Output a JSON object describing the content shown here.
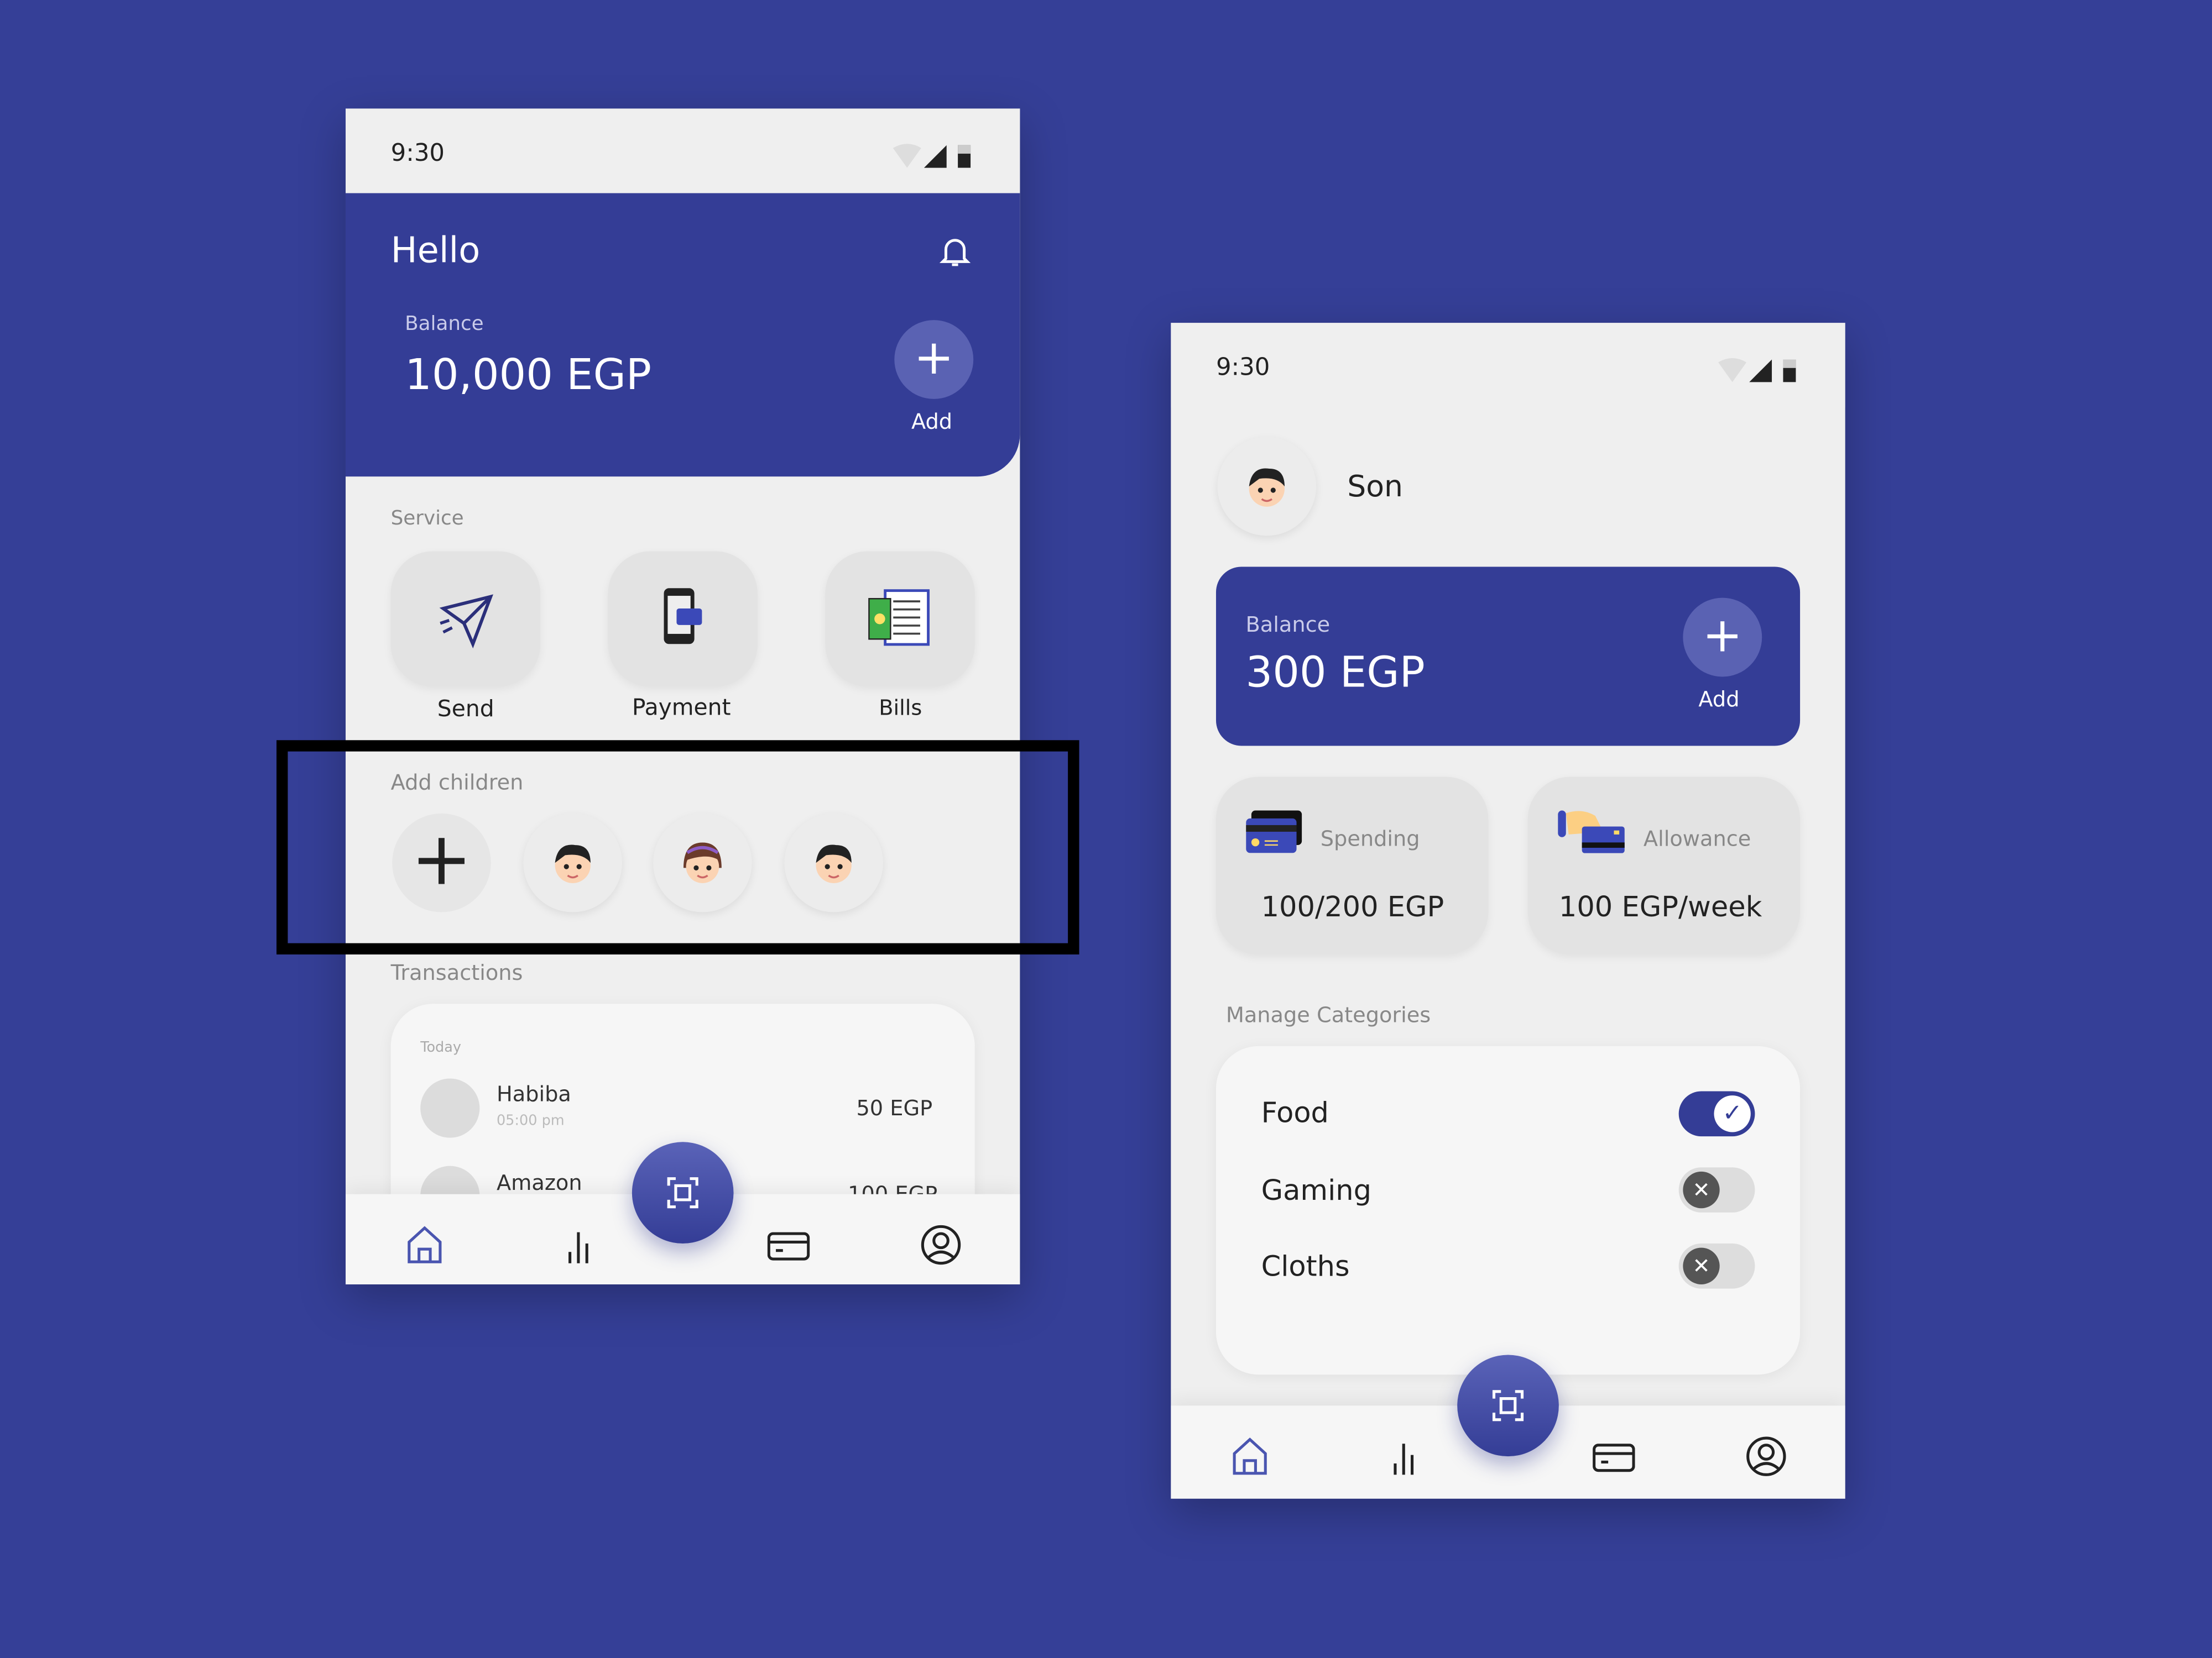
{
  "colors": {
    "background": "#353f97",
    "primary": "#343d96",
    "surface": "#efefef",
    "tile": "#e3e3e3"
  },
  "parent_screen": {
    "status": {
      "time": "9:30",
      "icons": [
        "wifi-icon",
        "signal-icon",
        "battery-icon"
      ]
    },
    "header": {
      "greeting": "Hello",
      "balance_label": "Balance",
      "balance_value": "10,000 EGP",
      "add_label": "Add",
      "icon": "bell-icon"
    },
    "service": {
      "title": "Service",
      "items": [
        {
          "label": "Send",
          "icon": "paper-plane-icon"
        },
        {
          "label": "Payment",
          "icon": "phone-payment-icon"
        },
        {
          "label": "Bills",
          "icon": "bill-icon"
        }
      ]
    },
    "children": {
      "title": "Add children",
      "add_icon": "plus-icon",
      "avatars": [
        "boy-avatar",
        "girl-avatar",
        "boy-avatar"
      ]
    },
    "transactions": {
      "title": "Transactions",
      "group": "Today",
      "items": [
        {
          "name": "Habiba",
          "time": "05:00 pm",
          "amount": "50 EGP"
        },
        {
          "name": "Amazon",
          "amount": "100 EGP"
        }
      ]
    },
    "nav": [
      "home-icon",
      "stats-icon",
      "scan-icon",
      "card-icon",
      "profile-icon"
    ]
  },
  "child_screen": {
    "status": {
      "time": "9:30"
    },
    "profile": {
      "name": "Son",
      "avatar": "boy-avatar"
    },
    "balance": {
      "label": "Balance",
      "value": "300 EGP",
      "add_label": "Add"
    },
    "stats": [
      {
        "label": "Spending",
        "value": "100/200 EGP",
        "icon": "card-icon"
      },
      {
        "label": "Allowance",
        "value": "100 EGP/week",
        "icon": "hand-card-icon"
      }
    ],
    "categories": {
      "title": "Manage Categories",
      "items": [
        {
          "label": "Food",
          "enabled": true
        },
        {
          "label": "Gaming",
          "enabled": false
        },
        {
          "label": "Cloths",
          "enabled": false
        }
      ]
    }
  }
}
